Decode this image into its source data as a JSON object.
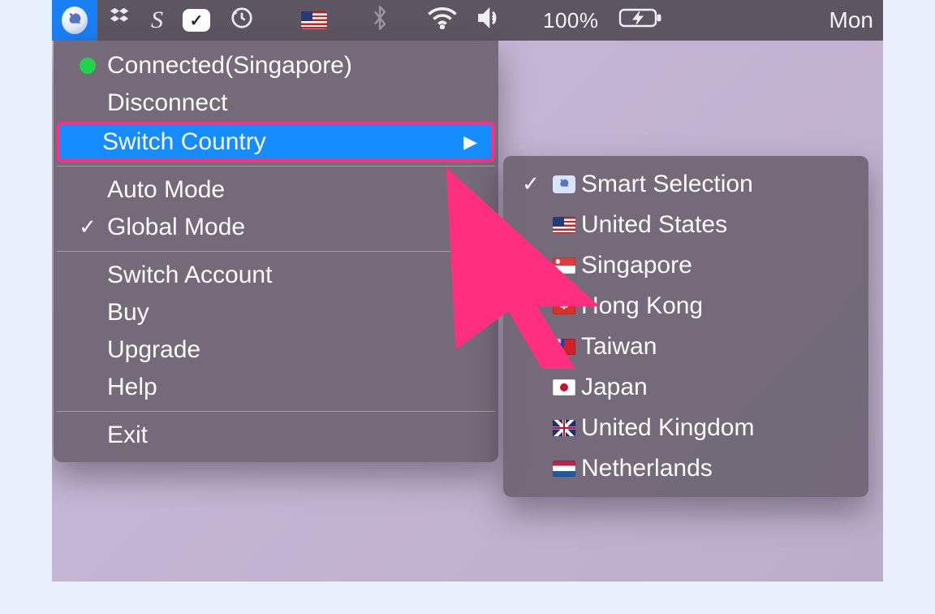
{
  "menubar": {
    "battery_pct": "100%",
    "clock_day": "Mon"
  },
  "menu": {
    "status": {
      "dot_color": "#22d24a",
      "label": "Connected(Singapore)"
    },
    "disconnect": "Disconnect",
    "switch_country": "Switch Country",
    "auto_mode": "Auto Mode",
    "global_mode": {
      "checked": true,
      "label": "Global Mode"
    },
    "switch_account": "Switch Account",
    "buy": "Buy",
    "upgrade": "Upgrade",
    "help": "Help",
    "exit": "Exit"
  },
  "countries": {
    "selected_index": 0,
    "items": [
      {
        "label": "Smart Selection",
        "flag": "smart"
      },
      {
        "label": "United States",
        "flag": "us"
      },
      {
        "label": "Singapore",
        "flag": "sg"
      },
      {
        "label": "Hong Kong",
        "flag": "hk"
      },
      {
        "label": "Taiwan",
        "flag": "tw"
      },
      {
        "label": "Japan",
        "flag": "jp"
      },
      {
        "label": "United Kingdom",
        "flag": "uk"
      },
      {
        "label": "Netherlands",
        "flag": "nl"
      }
    ]
  },
  "annotation": {
    "highlight_item": "switch_country",
    "arrow_color": "#ff2e7e"
  }
}
